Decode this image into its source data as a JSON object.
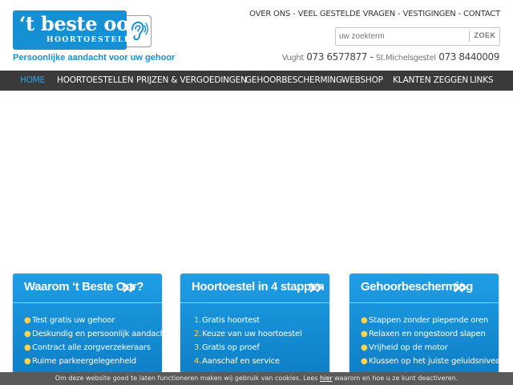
{
  "header": {
    "logo_title": "‘t beste oor",
    "logo_sub": "HOORTOESTELLEN",
    "tagline": "Persoonlijke aandacht voor uw gehoor",
    "topnav": [
      "OVER ONS",
      "VEEL GESTELDE VRAGEN",
      "VESTIGINGEN",
      "CONTACT"
    ],
    "topnav_sep": "-",
    "search": {
      "placeholder": "uw zoekterm",
      "button": "ZOEK"
    },
    "phones": [
      {
        "city": "Vught",
        "number": "073 6577877"
      },
      {
        "city": "St.Michelsgestel",
        "number": "073 8440009"
      }
    ],
    "phones_sep": "-"
  },
  "mainnav": {
    "items": [
      "HOME",
      "HOORTOESTELLEN",
      "PRIJZEN & VERGOEDINGEN",
      "GEHOORBESCHERMING",
      "WEBSHOP",
      "KLANTEN ZEGGEN",
      "LINKS"
    ],
    "active_index": 0
  },
  "cards": [
    {
      "title": "Waarom ‘t Beste Oor?",
      "list_style": "bullet",
      "items": [
        "Test gratis uw gehoor",
        "Deskundig en persoonlijk aandacht",
        "Contract alle zorgverzekeraars",
        "Ruime parkeergelegenheid"
      ]
    },
    {
      "title": "Hoortoestel in 4 stappen",
      "list_style": "numbered",
      "numbers": [
        "1.",
        "2.",
        "3.",
        "4."
      ],
      "items": [
        "Gratis hoortest",
        "Keuze van uw hoortoestel",
        "Gratis op proef",
        "Aanschaf en service"
      ]
    },
    {
      "title": "Gehoorbescherming",
      "list_style": "bullet",
      "items": [
        "Stappen zonder piepende oren",
        "Relaxen en ongestoord slapen",
        "Vrijheid op de motor",
        "Klussen op het juiste geluidsniveau"
      ]
    }
  ],
  "cookie": {
    "before": "Om deze website goed te laten functioneren maken wij gebruik van cookies. Lees",
    "link": "hier",
    "after": "waarom en hoe u ze kunt deactiveren."
  },
  "icons": {
    "ear": "ear-icon",
    "chevron": "double-chevron-right-icon",
    "bullet": "bullet-dot-icon"
  },
  "colors": {
    "brand_blue": "#1690d4",
    "nav_bg": "#3a3a3a",
    "nav_active": "#2ea3e6",
    "bullet_yellow": "#ffd34d",
    "cookie_bg": "#5a5a5a"
  }
}
